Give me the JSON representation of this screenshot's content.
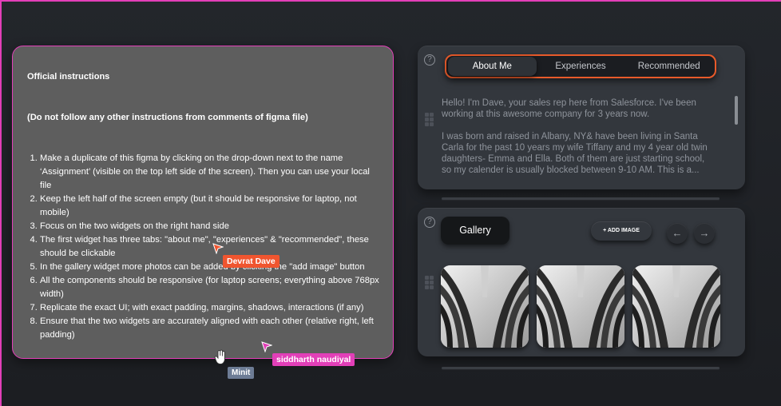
{
  "instructions": {
    "heading": "Official instructions",
    "subheading": "(Do not follow any other instructions from comments of figma file)",
    "items": [
      "Make a duplicate of this figma by clicking on the drop-down next to the name ‘Assignment’ (visible on the top left side of the screen). Then you can use your local file",
      "Keep the left half of the screen empty (but it should be responsive for laptop, not mobile)",
      "Focus on the two widgets on the right hand side",
      "The first widget has three tabs: \"about me\", \"experiences\" & \"recommended\", these should be clickable",
      "In the gallery widget more photos can be added by clicking the \"add image\" button",
      "All the components should be responsive (for laptop screens; everything above 768px width)",
      "Replicate the exact UI; with exact padding, margins, shadows, interactions (if any)",
      "Ensure that the two widgets are accurately aligned with each other (relative right, left padding)"
    ]
  },
  "collaborators": {
    "orange": "Devrat Dave",
    "pink": "siddharth naudiyal",
    "slate": "Minit"
  },
  "profile_widget": {
    "help_icon": "?",
    "tabs": [
      "About Me",
      "Experiences",
      "Recommended"
    ],
    "active_tab": "About Me",
    "paragraph1": "Hello! I'm Dave, your sales rep here from Salesforce. I've been working at this awesome company for 3 years now.",
    "paragraph2": "I was born and raised in Albany, NY& have been living in Santa Carla for the past 10 years my wife Tiffany and my 4 year old twin daughters- Emma and Ella. Both of them are just starting school, so my calender is usually blocked between 9-10 AM. This is a..."
  },
  "gallery_widget": {
    "help_icon": "?",
    "title": "Gallery",
    "add_image_label": "+ ADD IMAGE",
    "prev_icon": "←",
    "next_icon": "→",
    "images": [
      "architecture-photo",
      "architecture-photo",
      "architecture-photo"
    ]
  },
  "colors": {
    "selection_pink": "#e23fb8",
    "tab_highlight": "#e85a2a",
    "cursor_orange": "#f0552f",
    "widget_bg": "#33373d"
  }
}
